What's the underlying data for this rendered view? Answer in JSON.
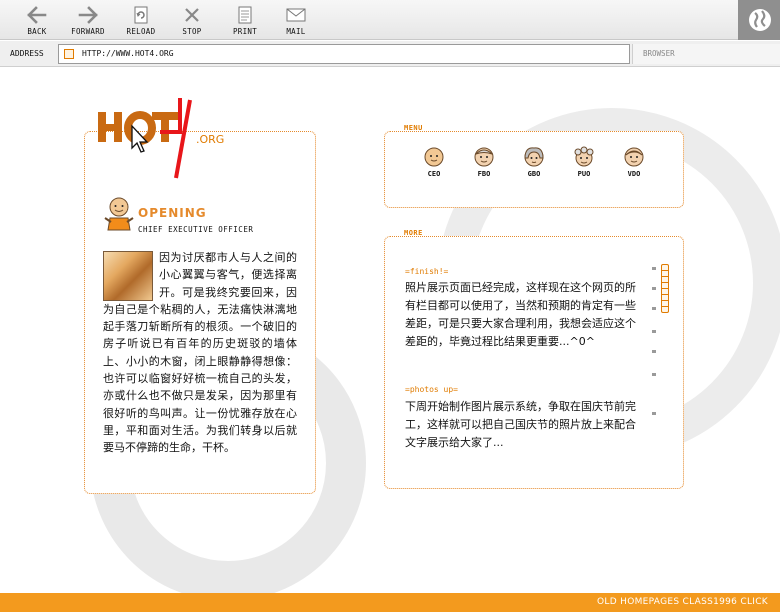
{
  "toolbar": {
    "buttons": [
      {
        "label": "BACK",
        "icon": "back-arrow-icon"
      },
      {
        "label": "FORWARD",
        "icon": "forward-arrow-icon"
      },
      {
        "label": "RELOAD",
        "icon": "reload-icon"
      },
      {
        "label": "STOP",
        "icon": "stop-x-icon"
      },
      {
        "label": "PRINT",
        "icon": "print-icon"
      },
      {
        "label": "MAIL",
        "icon": "mail-icon"
      }
    ],
    "globe_icon": "globe-icon"
  },
  "address": {
    "label": "ADDRESS",
    "url": "HTTP://WWW.HOT4.ORG",
    "right_label": "BROWSER"
  },
  "logo": {
    "wordmark": "HOT4",
    "suffix": ".ORG"
  },
  "opening": {
    "title": "OPENING",
    "subtitle": "CHIEF EXECUTIVE OFFICER",
    "body": "因为讨厌都市人与人之间的小心翼翼与客气，便选择离开。可是我终究要回来，因为自己是个粘稠的人，无法痛快淋漓地起手落刀斩断所有的根须。一个破旧的房子听说已有百年的历史斑驳的墙体上、小小的木窗，闭上眼静静得想像：也许可以临窗好好梳一梳自己的头发，亦或什么也不做只是发呆，因为那里有很好听的鸟叫声。让一份忧雅存放在心里，平和面对生活。为我们转身以后就要马不停蹄的生命，干杯。"
  },
  "menu": {
    "title": "MENU",
    "items": [
      {
        "label": "CEO"
      },
      {
        "label": "FBO"
      },
      {
        "label": "GBO"
      },
      {
        "label": "PUO"
      },
      {
        "label": "VDO"
      }
    ]
  },
  "more": {
    "title": "MORE",
    "entries": [
      {
        "heading": "=finish!=",
        "text": "照片展示页面已经完成，这样现在这个网页的所有栏目都可以使用了，当然和预期的肯定有一些差距，可是只要大家合理利用，我想会适应这个差距的，毕竟过程比结果更重要...^0^"
      },
      {
        "heading": "=photos up=",
        "text": "下周开始制作图片展示系统，争取在国庆节前完工，这样就可以把自己国庆节的照片放上来配合文字展示给大家了..."
      }
    ]
  },
  "footer": {
    "text": "OLD HOMEPAGES CLASS1996 CLICK"
  },
  "colors": {
    "accent": "#e07b00",
    "footer": "#f39a1e",
    "logo_red": "#e8161a"
  }
}
